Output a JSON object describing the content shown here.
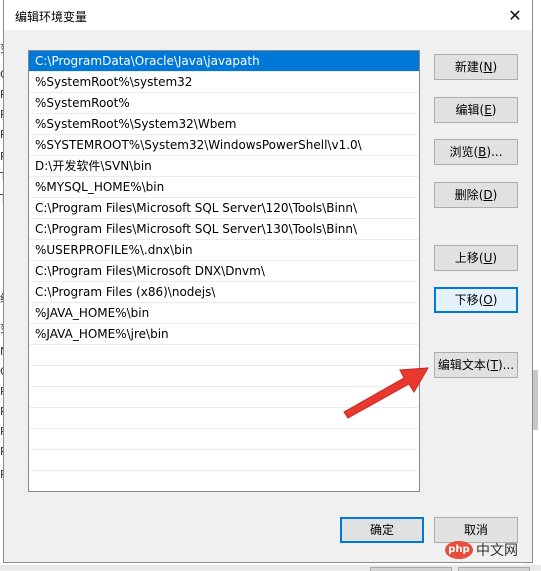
{
  "background": {
    "strip_letters": [
      "变",
      "O",
      "Pa",
      "PA",
      "PF",
      "PF",
      "TE",
      "TM",
      "统",
      "变",
      "N",
      "O",
      "Pa",
      "PA",
      "PF",
      "PF",
      "PF"
    ]
  },
  "dialog": {
    "title": "编辑环境变量",
    "close_glyph": "✕"
  },
  "list": {
    "items": [
      "C:\\ProgramData\\Oracle\\Java\\javapath",
      "%SystemRoot%\\system32",
      "%SystemRoot%",
      "%SystemRoot%\\System32\\Wbem",
      "%SYSTEMROOT%\\System32\\WindowsPowerShell\\v1.0\\",
      "D:\\开发软件\\SVN\\bin",
      "%MYSQL_HOME%\\bin",
      "C:\\Program Files\\Microsoft SQL Server\\120\\Tools\\Binn\\",
      "C:\\Program Files\\Microsoft SQL Server\\130\\Tools\\Binn\\",
      "%USERPROFILE%\\.dnx\\bin",
      "C:\\Program Files\\Microsoft DNX\\Dnvm\\",
      "C:\\Program Files (x86)\\nodejs\\",
      "%JAVA_HOME%\\bin",
      "%JAVA_HOME%\\jre\\bin"
    ],
    "selected_index": 0
  },
  "buttons": {
    "new": {
      "label": "新建",
      "key": "N"
    },
    "edit": {
      "label": "编辑",
      "key": "E"
    },
    "browse": {
      "label": "浏览",
      "key": "B",
      "suffix": "..."
    },
    "delete": {
      "label": "删除",
      "key": "D"
    },
    "move_up": {
      "label": "上移",
      "key": "U"
    },
    "move_down": {
      "label": "下移",
      "key": "O"
    },
    "edit_text": {
      "label": "编辑文本",
      "key": "T",
      "suffix": "..."
    },
    "ok": {
      "label": "确定"
    },
    "cancel": {
      "label": "取消"
    }
  },
  "watermark": {
    "logo": "php",
    "text": "中文网"
  },
  "colors": {
    "selection": "#0078d7",
    "arrow": "#e8382f"
  }
}
